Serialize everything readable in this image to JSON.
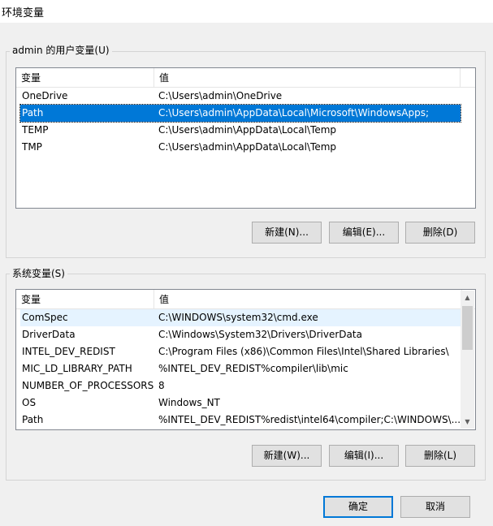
{
  "window": {
    "title": "环境变量"
  },
  "user_vars": {
    "group_label": "admin 的用户变量(U)",
    "columns": [
      "变量",
      "值"
    ],
    "rows": [
      {
        "name": "OneDrive",
        "value": "C:\\Users\\admin\\OneDrive"
      },
      {
        "name": "Path",
        "value": "C:\\Users\\admin\\AppData\\Local\\Microsoft\\WindowsApps;"
      },
      {
        "name": "TEMP",
        "value": "C:\\Users\\admin\\AppData\\Local\\Temp"
      },
      {
        "name": "TMP",
        "value": "C:\\Users\\admin\\AppData\\Local\\Temp"
      }
    ],
    "selected_row": 1,
    "new_label": "新建(N)...",
    "edit_label": "编辑(E)...",
    "delete_label": "删除(D)"
  },
  "system_vars": {
    "group_label": "系统变量(S)",
    "columns": [
      "变量",
      "值"
    ],
    "rows": [
      {
        "name": "ComSpec",
        "value": "C:\\WINDOWS\\system32\\cmd.exe"
      },
      {
        "name": "DriverData",
        "value": "C:\\Windows\\System32\\Drivers\\DriverData"
      },
      {
        "name": "INTEL_DEV_REDIST",
        "value": "C:\\Program Files (x86)\\Common Files\\Intel\\Shared Libraries\\"
      },
      {
        "name": "MIC_LD_LIBRARY_PATH",
        "value": "%INTEL_DEV_REDIST%compiler\\lib\\mic"
      },
      {
        "name": "NUMBER_OF_PROCESSORS",
        "value": "8"
      },
      {
        "name": "OS",
        "value": "Windows_NT"
      },
      {
        "name": "Path",
        "value": "%INTEL_DEV_REDIST%redist\\intel64\\compiler;C:\\WINDOWS\\..."
      }
    ],
    "hover_row": 0,
    "new_label": "新建(W)...",
    "edit_label": "编辑(I)...",
    "delete_label": "删除(L)"
  },
  "footer": {
    "ok_label": "确定",
    "cancel_label": "取消"
  },
  "icons": {
    "scroll_up": "chevron-up-icon",
    "scroll_down": "chevron-down-icon"
  },
  "colors": {
    "selection": "#0078d7",
    "hover": "#e5f3ff"
  }
}
